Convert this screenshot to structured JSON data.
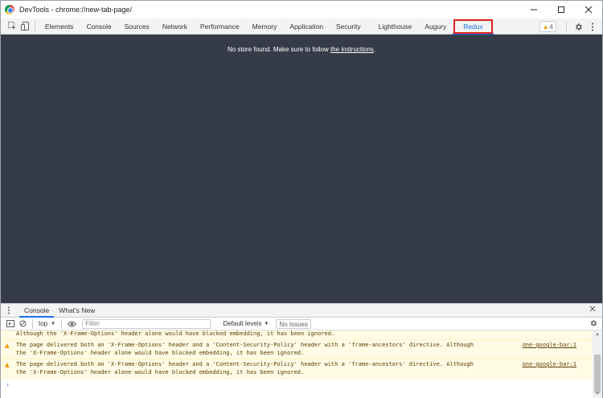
{
  "window": {
    "title": "DevTools - chrome://new-tab-page/"
  },
  "toolbar": {
    "tabs": [
      {
        "label": "Elements"
      },
      {
        "label": "Console"
      },
      {
        "label": "Sources"
      },
      {
        "label": "Network"
      },
      {
        "label": "Performance"
      },
      {
        "label": "Memory"
      },
      {
        "label": "Application"
      },
      {
        "label": "Security"
      },
      {
        "label": "Lighthouse"
      },
      {
        "label": "Augury"
      },
      {
        "label": "Redux"
      }
    ],
    "active_tab": "Redux",
    "warning_count": "4"
  },
  "panel": {
    "message_prefix": "No store found. Make sure to follow ",
    "link_text": "the instructions",
    "message_suffix": "."
  },
  "drawer": {
    "tabs": [
      {
        "label": "Console"
      },
      {
        "label": "What's New"
      }
    ]
  },
  "console_bar": {
    "context": "top",
    "filter_placeholder": "Filter",
    "levels": "Default levels",
    "issues": "No Issues"
  },
  "messages": {
    "partial": "Although the 'X-Frame-Options' header alone would have blocked embedding, it has been ignored.",
    "items": [
      {
        "line1": "The page delivered both an 'X-Frame-Options' header and a 'Content-Security-Policy' header with a 'frame-ancestors' directive. Although",
        "line2": "the 'X-Frame-Options' header alone would have blocked embedding, it has been ignored.",
        "source": "one-google-bar:1"
      },
      {
        "line1": "The page delivered both an 'X-Frame-Options' header and a 'Content-Security-Policy' header with a 'frame-ancestors' directive. Although",
        "line2": "the 'X-Frame-Options' header alone would have blocked embedding, it has been ignored.",
        "source": "one-google-bar:1"
      }
    ],
    "prompt": "›"
  },
  "colors": {
    "panel_bg": "#353b48",
    "accent": "#1a73e8",
    "highlight_box": "#e02020",
    "warning_bg": "#fffbe5"
  }
}
